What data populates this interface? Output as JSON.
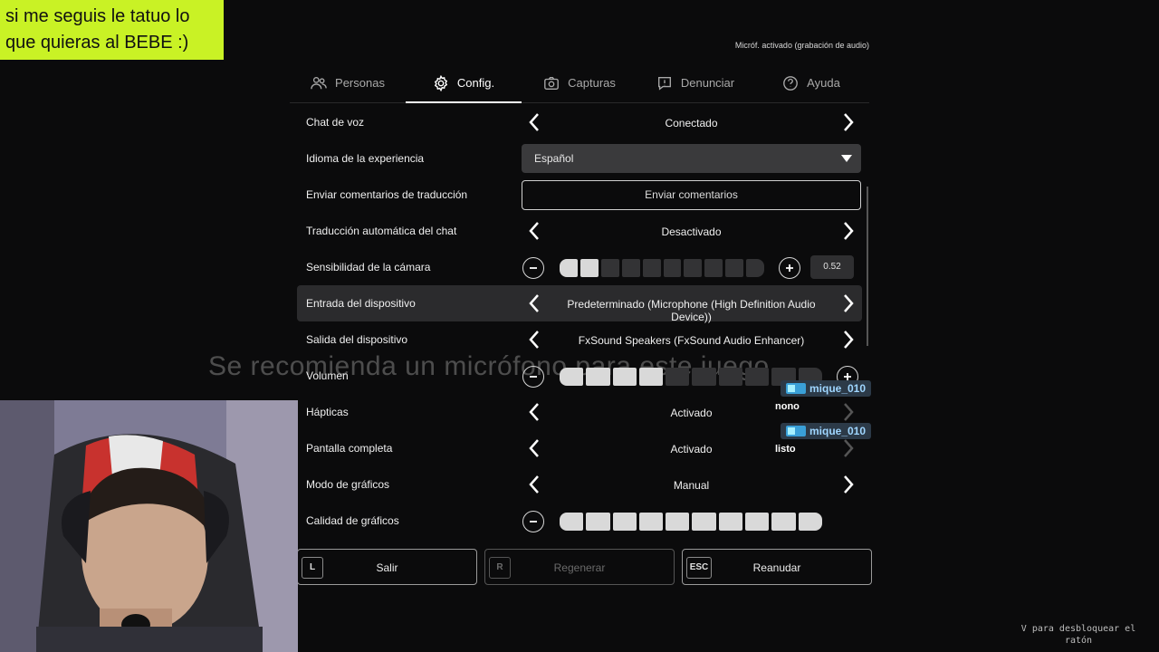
{
  "overlay": {
    "text": "si me seguis le tatuo lo que quieras al BEBE :)"
  },
  "mic_status": "Micróf. activado (grabación de audio)",
  "tabs": [
    {
      "label": "Personas",
      "icon": "people-icon",
      "active": false
    },
    {
      "label": "Config.",
      "icon": "gear-icon",
      "active": true
    },
    {
      "label": "Capturas",
      "icon": "camera-icon",
      "active": false
    },
    {
      "label": "Denunciar",
      "icon": "report-icon",
      "active": false
    },
    {
      "label": "Ayuda",
      "icon": "help-icon",
      "active": false
    }
  ],
  "settings": {
    "voice_chat": {
      "label": "Chat de voz",
      "value": "Conectado"
    },
    "language": {
      "label": "Idioma de la experiencia",
      "value": "Español"
    },
    "translation_feedback": {
      "label": "Enviar comentarios de traducción",
      "button": "Enviar comentarios"
    },
    "auto_translate": {
      "label": "Traducción automática del chat",
      "value": "Desactivado"
    },
    "camera_sensitivity": {
      "label": "Sensibilidad de la cámara",
      "value": "0.52",
      "level_segments": 2,
      "total_segments": 10
    },
    "input_device": {
      "label": "Entrada del dispositivo",
      "value": "Predeterminado (Microphone (High Definition Audio Device))"
    },
    "output_device": {
      "label": "Salida del dispositivo",
      "value": "FxSound Speakers (FxSound Audio Enhancer)"
    },
    "volume": {
      "label": "Volumen",
      "level_segments": 4,
      "total_segments": 10
    },
    "haptics": {
      "label": "Hápticas",
      "value": "Activado"
    },
    "fullscreen": {
      "label": "Pantalla completa",
      "value": "Activado"
    },
    "graphics_mode": {
      "label": "Modo de gráficos",
      "value": "Manual"
    },
    "graphics_quality": {
      "label": "Calidad de gráficos",
      "level_segments": 10,
      "total_segments": 10
    }
  },
  "bottom_buttons": {
    "leave": {
      "key": "L",
      "label": "Salir"
    },
    "respawn": {
      "key": "R",
      "label": "Regenerar"
    },
    "resume": {
      "key": "ESC",
      "label": "Reanudar"
    }
  },
  "chat": [
    {
      "user": "mique_010",
      "text": "nono"
    },
    {
      "user": "mique_010",
      "text": "listo"
    }
  ],
  "background_subtitle": "Se recomienda un micrófono para este juego.",
  "unlock_hint": "V para desbloquear el ratón",
  "colors": {
    "overlay_bg": "#c9f225",
    "panel_bg": "#0b0b0c",
    "highlight_row": "#2b2b2d",
    "chat_name": "#9fd6ff"
  }
}
